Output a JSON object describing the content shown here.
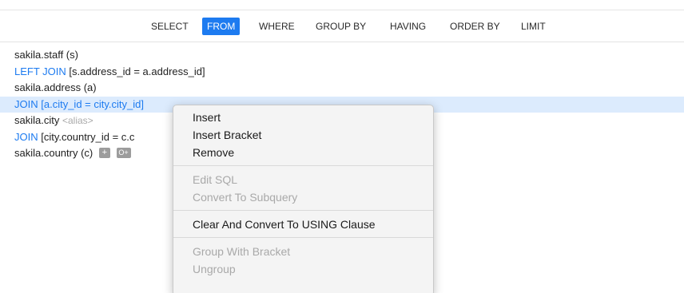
{
  "tabs": [
    "SELECT",
    "FROM",
    "WHERE",
    "GROUP BY",
    "HAVING",
    "ORDER BY",
    "LIMIT"
  ],
  "active_tab": "FROM",
  "lines": {
    "l1": "sakila.staff  (s)",
    "l2_kw": "LEFT JOIN",
    "l2_cond": "[s.address_id = a.address_id]",
    "l3": "sakila.address  (a)",
    "l4_kw": "JOIN",
    "l4_cond": "[a.city_id = city.city_id]",
    "l5": "sakila.city",
    "l5_alias": "<alias>",
    "l6_kw": "JOIN",
    "l6_cond": "[city.country_id = c.c",
    "l7": "sakila.country  (c)",
    "btn_add": "+",
    "btn_join": "O+"
  },
  "menu": {
    "insert": "Insert",
    "insert_bracket": "Insert Bracket",
    "remove": "Remove",
    "edit_sql": "Edit SQL",
    "convert_subquery": "Convert To Subquery",
    "clear_convert_using": "Clear And Convert To USING Clause",
    "group_bracket": "Group With Bracket",
    "ungroup": "Ungroup"
  },
  "colors": {
    "accent": "#1d7bf0",
    "selection": "#dcebfd",
    "disabled": "#a9a9a9"
  }
}
